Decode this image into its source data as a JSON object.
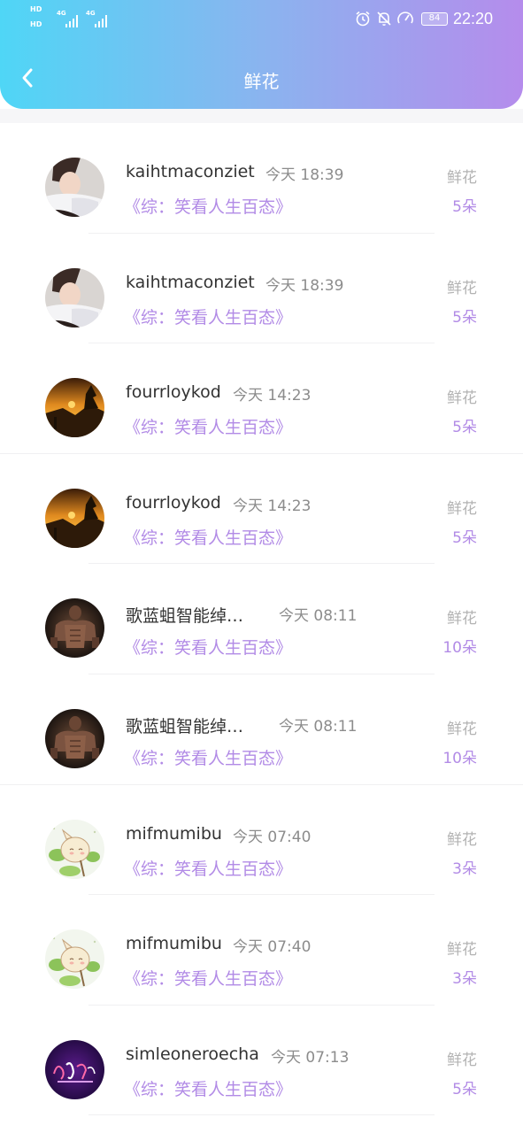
{
  "status_bar": {
    "hd1": "HD",
    "hd2": "HD",
    "net1": "4G",
    "net2": "4G",
    "battery": "84",
    "time": "22:20"
  },
  "nav": {
    "title": "鲜花"
  },
  "colors": {
    "accent": "#b28be6",
    "header_start": "#4fd6f6",
    "header_end": "#b58cec"
  },
  "items": [
    {
      "name": "kaihtmaconziet",
      "time": "今天 18:39",
      "book": "《综：笑看人生百态》",
      "gift_label": "鲜花",
      "gift_count": "5朵",
      "avatar": "portrait-avatar"
    },
    {
      "name": "kaihtmaconziet",
      "time": "今天 18:39",
      "book": "《综：笑看人生百态》",
      "gift_label": "鲜花",
      "gift_count": "5朵",
      "avatar": "portrait-avatar"
    },
    {
      "name": "fourrloykod",
      "time": "今天 14:23",
      "book": "《综：笑看人生百态》",
      "gift_label": "鲜花",
      "gift_count": "5朵",
      "avatar": "sunset-avatar"
    },
    {
      "name": "fourrloykod",
      "time": "今天 14:23",
      "book": "《综：笑看人生百态》",
      "gift_label": "鲜花",
      "gift_count": "5朵",
      "avatar": "sunset-avatar"
    },
    {
      "name": "歌蓝蛆智能绰…",
      "time": "今天 08:11",
      "book": "《综：笑看人生百态》",
      "gift_label": "鲜花",
      "gift_count": "10朵",
      "avatar": "muscle-avatar"
    },
    {
      "name": "歌蓝蛆智能绰…",
      "time": "今天 08:11",
      "book": "《综：笑看人生百态》",
      "gift_label": "鲜花",
      "gift_count": "10朵",
      "avatar": "muscle-avatar"
    },
    {
      "name": "mifmumibu",
      "time": "今天 07:40",
      "book": "《综：笑看人生百态》",
      "gift_label": "鲜花",
      "gift_count": "3朵",
      "avatar": "cartoon-avatar"
    },
    {
      "name": "mifmumibu",
      "time": "今天 07:40",
      "book": "《综：笑看人生百态》",
      "gift_label": "鲜花",
      "gift_count": "3朵",
      "avatar": "cartoon-avatar"
    },
    {
      "name": "simleoneroecha",
      "time": "今天 07:13",
      "book": "《综：笑看人生百态》",
      "gift_label": "鲜花",
      "gift_count": "5朵",
      "avatar": "calligraphy-avatar"
    }
  ]
}
